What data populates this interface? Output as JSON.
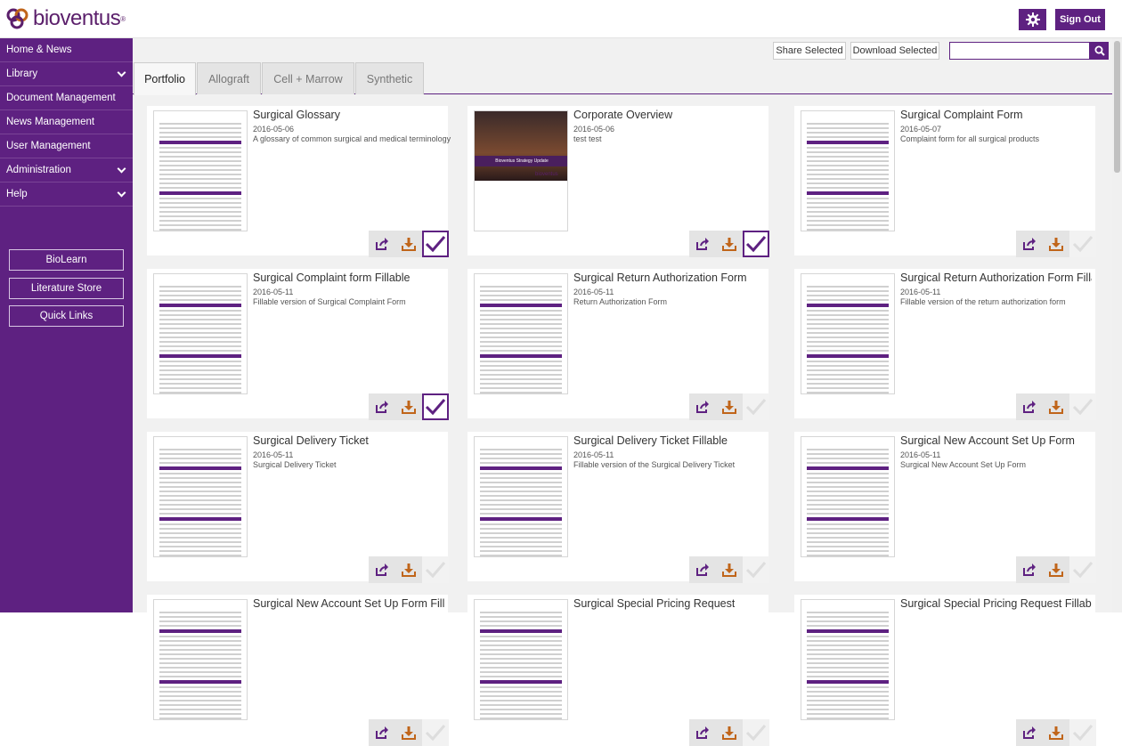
{
  "header": {
    "brand": "bioventus",
    "reg": "®",
    "signout": "Sign Out",
    "gear_icon": "gear-icon"
  },
  "sidebar": {
    "items": [
      {
        "label": "Home & News",
        "has_chevron": false
      },
      {
        "label": "Library",
        "has_chevron": true
      },
      {
        "label": "Document Management",
        "has_chevron": false
      },
      {
        "label": "News Management",
        "has_chevron": false
      },
      {
        "label": "User Management",
        "has_chevron": false
      },
      {
        "label": "Administration",
        "has_chevron": true
      },
      {
        "label": "Help",
        "has_chevron": true
      }
    ],
    "buttons": [
      "BioLearn",
      "Literature Store",
      "Quick Links"
    ]
  },
  "toolbar": {
    "share": "Share Selected",
    "download": "Download Selected",
    "search_placeholder": ""
  },
  "tabs": [
    "Portfolio",
    "Allograft",
    "Cell + Marrow",
    "Synthetic"
  ],
  "active_tab": "Portfolio",
  "cards": [
    {
      "title": "Surgical Glossary",
      "date": "2016-05-06",
      "desc": "A glossary of common surgical and medical terminology",
      "selected": true
    },
    {
      "title": "Corporate Overview",
      "date": "2016-05-06",
      "desc": "test test",
      "selected": true,
      "thumb_caption": "Bioventus Strategy Update"
    },
    {
      "title": "Surgical Complaint Form",
      "date": "2016-05-07",
      "desc": "Complaint form for all surgical products",
      "selected": false
    },
    {
      "title": "Surgical Complaint form Fillable",
      "date": "2016-05-11",
      "desc": "Fillable version of Surgical Complaint Form",
      "selected": true
    },
    {
      "title": "Surgical Return Authorization Form",
      "date": "2016-05-11",
      "desc": "Return Authorization Form",
      "selected": false
    },
    {
      "title": "Surgical Return Authorization Form Fillable",
      "date": "2016-05-11",
      "desc": "Fillable version of the return authorization form",
      "selected": false
    },
    {
      "title": "Surgical Delivery Ticket",
      "date": "2016-05-11",
      "desc": "Surgical Delivery Ticket",
      "selected": false
    },
    {
      "title": "Surgical Delivery Ticket Fillable",
      "date": "2016-05-11",
      "desc": "Fillable version of the Surgical Delivery Ticket",
      "selected": false
    },
    {
      "title": "Surgical New Account Set Up Form",
      "date": "2016-05-11",
      "desc": "Surgical New Account Set Up Form",
      "selected": false
    },
    {
      "title": "Surgical New Account Set Up Form Fillable",
      "date": "",
      "desc": "",
      "selected": false
    },
    {
      "title": "Surgical Special Pricing Request",
      "date": "",
      "desc": "",
      "selected": false
    },
    {
      "title": "Surgical Special Pricing Request Fillable",
      "date": "",
      "desc": "",
      "selected": false
    }
  ],
  "colors": {
    "brand": "#5e2181",
    "download": "#c0651a"
  }
}
